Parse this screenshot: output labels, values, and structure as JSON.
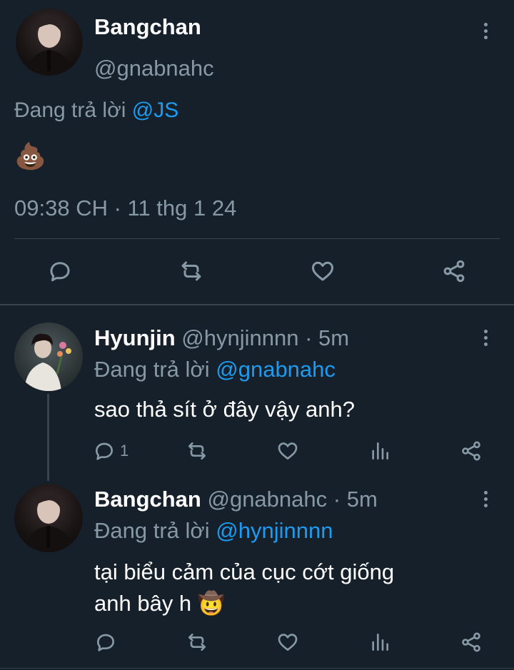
{
  "main_tweet": {
    "author_name": "Bangchan",
    "author_handle": "@gnabnahc",
    "replying_label": "Đang trả lời",
    "replying_to": "@JS",
    "content": "💩",
    "timestamp": "09:38 CH · 11 thg 1 24"
  },
  "replies": [
    {
      "author_name": "Hyunjin",
      "author_handle": "@hynjinnnn",
      "time": "· 5m",
      "replying_label": "Đang trả lời",
      "replying_to": "@gnabnahc",
      "content": "sao thả sít ở đây vậy anh?",
      "reply_count": "1"
    },
    {
      "author_name": "Bangchan",
      "author_handle": "@gnabnahc",
      "time": "· 5m",
      "replying_label": "Đang trả lời",
      "replying_to": "@hynjinnnn",
      "content_line1": "tại biểu cảm của cục cớt giống",
      "content_line2": "anh bây h",
      "content_emoji": "🤠"
    }
  ],
  "colors": {
    "background": "#15202b",
    "link": "#1d9bf0",
    "muted": "#8899a6",
    "divider": "#38444d"
  },
  "icons": [
    "more-icon",
    "reply-icon",
    "retweet-icon",
    "like-icon",
    "share-icon",
    "analytics-icon"
  ]
}
